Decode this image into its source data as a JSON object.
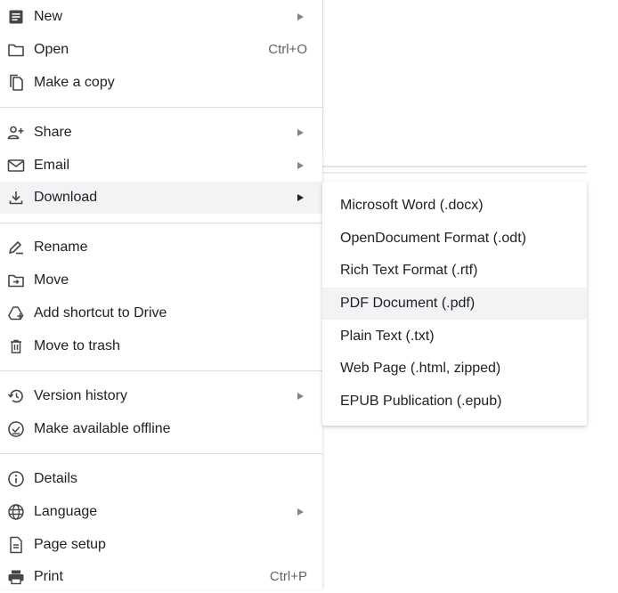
{
  "file_menu": {
    "items": [
      {
        "label": "New",
        "icon": "document-icon",
        "has_submenu": true
      },
      {
        "label": "Open",
        "icon": "folder-icon",
        "shortcut": "Ctrl+O"
      },
      {
        "label": "Make a copy",
        "icon": "copy-icon"
      },
      {
        "label": "Share",
        "icon": "person-add-icon",
        "has_submenu": true
      },
      {
        "label": "Email",
        "icon": "mail-icon",
        "has_submenu": true
      },
      {
        "label": "Download",
        "icon": "download-icon",
        "has_submenu": true,
        "active": true
      },
      {
        "label": "Rename",
        "icon": "pencil-icon"
      },
      {
        "label": "Move",
        "icon": "folder-move-icon"
      },
      {
        "label": "Add shortcut to Drive",
        "icon": "drive-shortcut-icon"
      },
      {
        "label": "Move to trash",
        "icon": "trash-icon"
      },
      {
        "label": "Version history",
        "icon": "history-icon",
        "has_submenu": true
      },
      {
        "label": "Make available offline",
        "icon": "offline-check-icon"
      },
      {
        "label": "Details",
        "icon": "info-icon"
      },
      {
        "label": "Language",
        "icon": "globe-icon",
        "has_submenu": true
      },
      {
        "label": "Page setup",
        "icon": "page-setup-icon"
      },
      {
        "label": "Print",
        "icon": "printer-icon",
        "shortcut": "Ctrl+P"
      }
    ]
  },
  "download_submenu": {
    "items": [
      {
        "label": "Microsoft Word (.docx)"
      },
      {
        "label": "OpenDocument Format (.odt)"
      },
      {
        "label": "Rich Text Format (.rtf)"
      },
      {
        "label": "PDF Document (.pdf)",
        "hovered": true
      },
      {
        "label": "Plain Text (.txt)"
      },
      {
        "label": "Web Page (.html, zipped)"
      },
      {
        "label": "EPUB Publication (.epub)"
      }
    ]
  },
  "colors": {
    "text": "#202124",
    "muted": "#5f6368",
    "icon": "#444746",
    "highlight": "#f1f3f4",
    "divider": "#dadce0"
  }
}
